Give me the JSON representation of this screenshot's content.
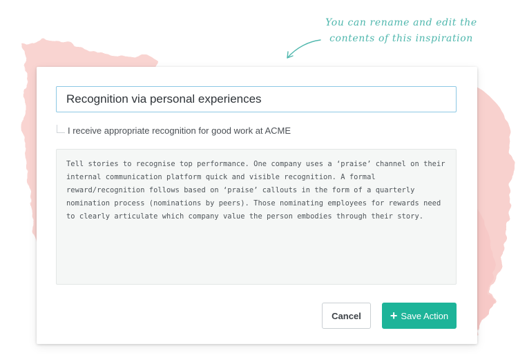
{
  "annotation": {
    "line1": "You can rename and edit the",
    "line2": "contents of this inspiration"
  },
  "modal": {
    "title_value": "Recognition via personal experiences",
    "question_label": "I receive appropriate recognition for good work at ACME",
    "description": "Tell stories to recognise top performance. One company uses a ‘praise’ channel on their internal communication platform quick and visible recognition. A formal reward/recognition follows based on ‘praise’ callouts in the form of a quarterly nomination process (nominations by peers). Those nominating employees for rewards need to clearly articulate which company value the person embodies through their story.",
    "cancel_label": "Cancel",
    "save_label": "Save Action",
    "save_icon": "plus-icon"
  },
  "colors": {
    "accent": "#1db499",
    "annotation": "#4fb7ad",
    "input_border": "#8cc8e4",
    "watercolor": "#f7c9c6"
  }
}
